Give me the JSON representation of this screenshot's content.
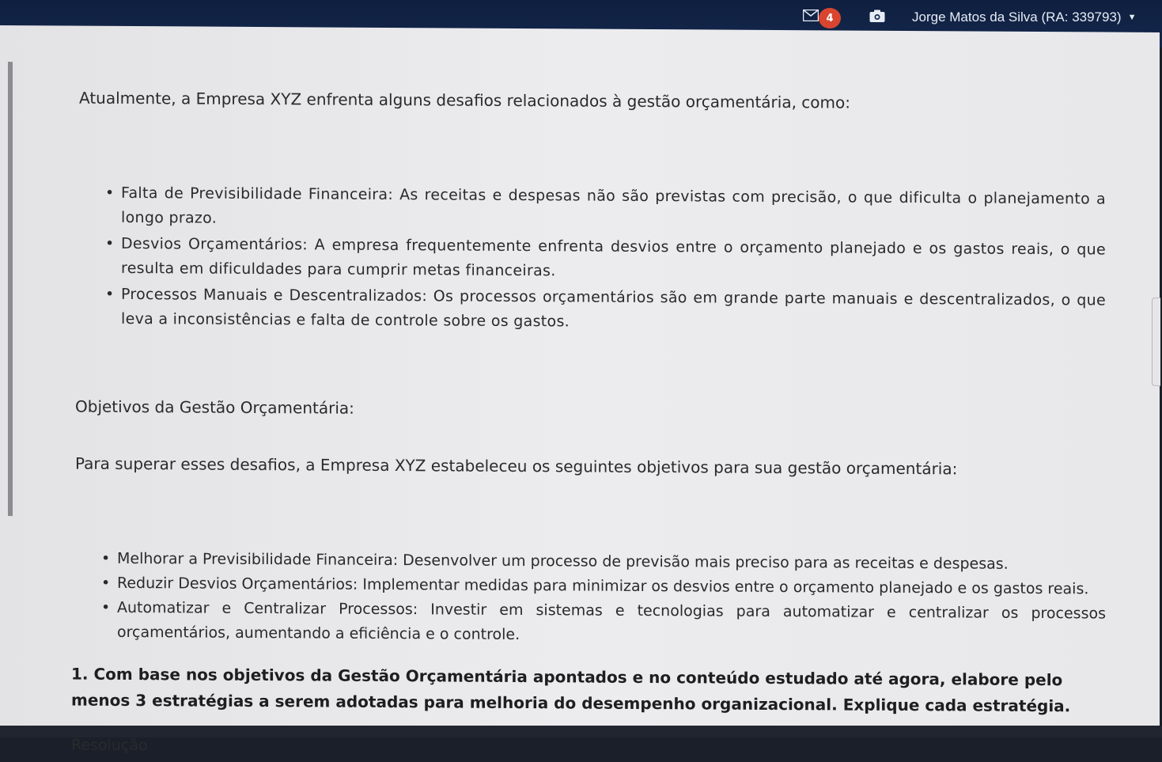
{
  "header": {
    "mail_count": "4",
    "user_label": "Jorge Matos da Silva (RA: 339793)"
  },
  "content": {
    "intro": "Atualmente, a Empresa XYZ enfrenta alguns desafios relacionados à gestão orçamentária, como:",
    "challenges": [
      "Falta de Previsibilidade Financeira: As receitas e despesas não são previstas com precisão, o que dificulta o planejamento a longo prazo.",
      "Desvios Orçamentários: A empresa frequentemente enfrenta desvios entre o orçamento planejado e os gastos reais, o que resulta em dificuldades para cumprir metas financeiras.",
      "Processos Manuais e Descentralizados: Os processos orçamentários são em grande parte manuais e descentralizados, o que leva a inconsistências e falta de controle sobre os gastos."
    ],
    "objectives_title": "Objetivos da Gestão Orçamentária:",
    "objectives_intro": "Para superar esses desafios, a Empresa XYZ estabeleceu os seguintes objetivos para sua gestão orçamentária:",
    "objectives": [
      "Melhorar a Previsibilidade Financeira: Desenvolver um processo de previsão mais preciso para as receitas e despesas.",
      "Reduzir Desvios Orçamentários: Implementar medidas para minimizar os desvios entre o orçamento planejado e os gastos reais.",
      "Automatizar e Centralizar Processos: Investir em sistemas e tecnologias para automatizar e centralizar os processos orçamentários, aumentando a eficiência e o controle."
    ],
    "question": "1. Com base nos objetivos da Gestão Orçamentária apontados e no conteúdo estudado até agora, elabore pelo menos 3 estratégias a serem adotadas para melhoria do desempenho organizacional. Explique cada estratégia.",
    "resolution_label": "Resolução"
  },
  "icons": {
    "mail": "mail-icon",
    "camera": "camera-icon",
    "caret": "caret-down-icon"
  },
  "colors": {
    "header_bg": "#0f1f3f",
    "badge": "#d9452f",
    "page_bg": "#ececee",
    "text": "#2a2a2d"
  }
}
